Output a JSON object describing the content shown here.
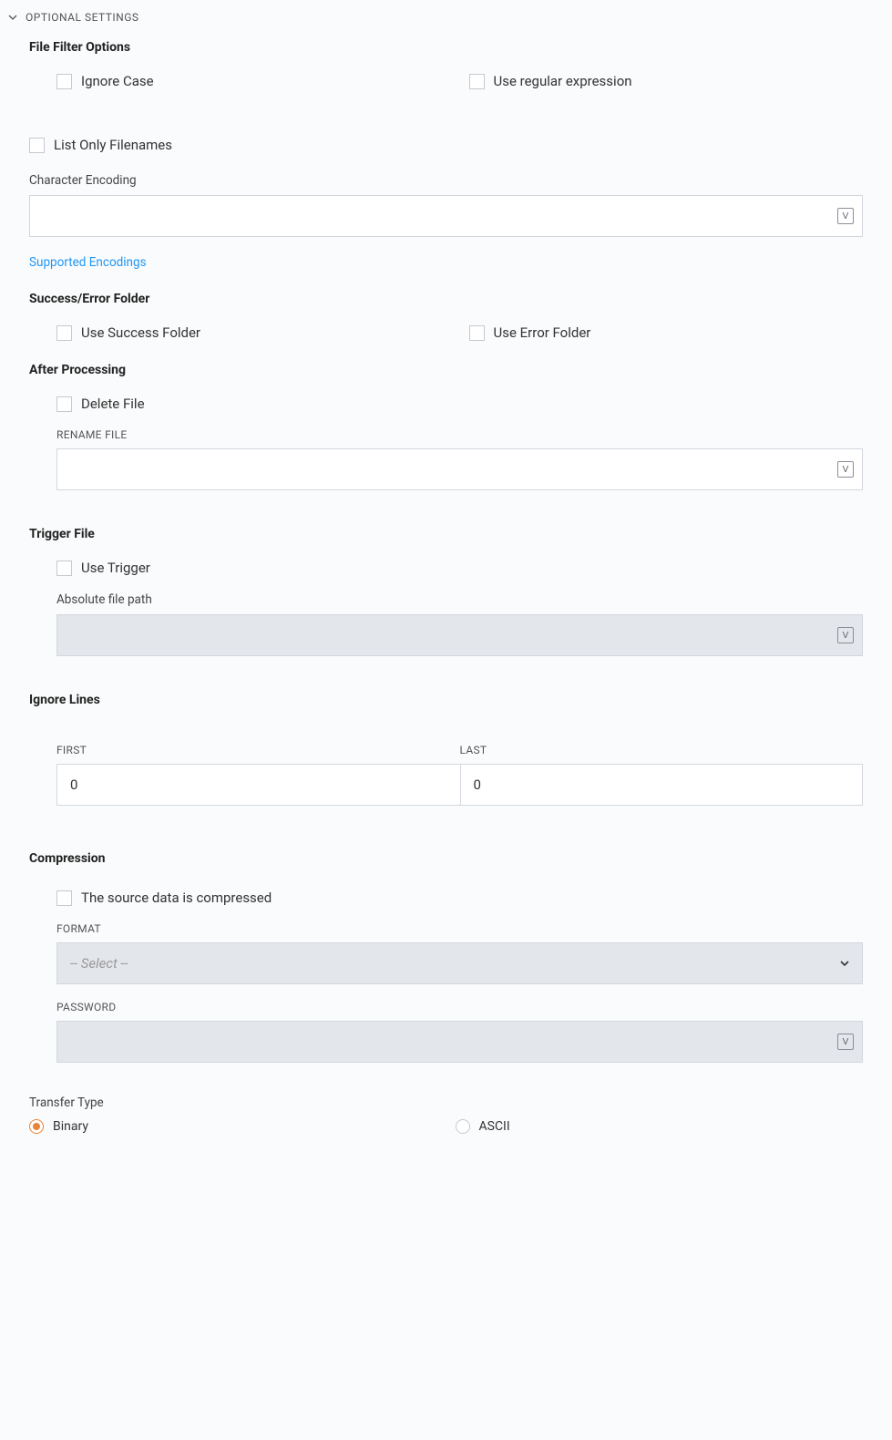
{
  "header": {
    "title": "OPTIONAL SETTINGS"
  },
  "fileFilter": {
    "heading": "File Filter Options",
    "ignoreCase": "Ignore Case",
    "useRegex": "Use regular expression",
    "listOnlyFilenames": "List Only Filenames",
    "charEncodingLabel": "Character Encoding",
    "charEncodingValue": "",
    "supportedEncodingsLink": "Supported Encodings"
  },
  "successError": {
    "heading": "Success/Error Folder",
    "useSuccess": "Use Success Folder",
    "useError": "Use Error Folder"
  },
  "afterProcessing": {
    "heading": "After Processing",
    "deleteFile": "Delete File",
    "renameFileLabel": "RENAME FILE",
    "renameFileValue": ""
  },
  "triggerFile": {
    "heading": "Trigger File",
    "useTrigger": "Use Trigger",
    "pathLabel": "Absolute file path",
    "pathValue": ""
  },
  "ignoreLines": {
    "heading": "Ignore Lines",
    "firstLabel": "FIRST",
    "firstValue": "0",
    "lastLabel": "LAST",
    "lastValue": "0"
  },
  "compression": {
    "heading": "Compression",
    "sourceCompressed": "The source data is compressed",
    "formatLabel": "FORMAT",
    "formatPlaceholder": "-- Select --",
    "passwordLabel": "PASSWORD",
    "passwordValue": ""
  },
  "transferType": {
    "heading": "Transfer Type",
    "binary": "Binary",
    "ascii": "ASCII"
  }
}
